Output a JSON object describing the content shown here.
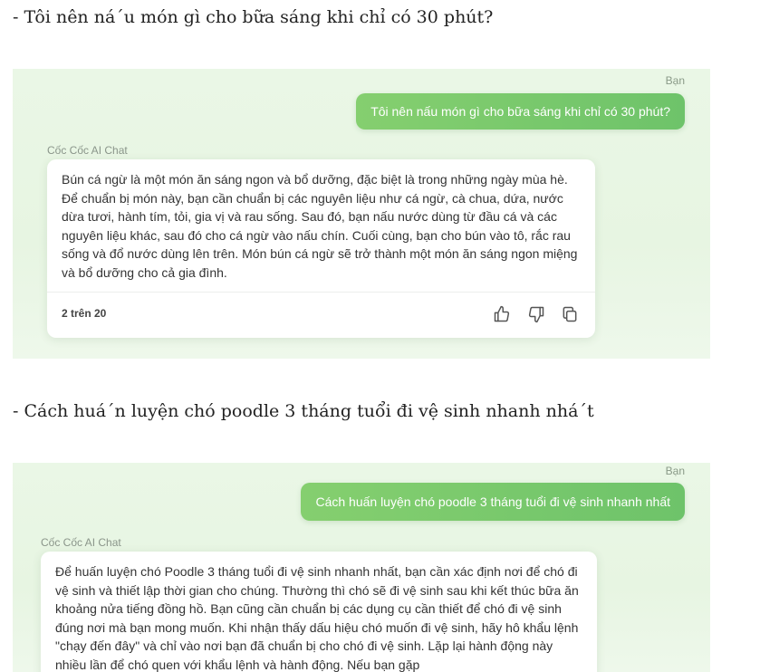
{
  "sections": [
    {
      "heading": "- Tôi nên ná´u món gì cho bữa sáng khi chỉ có 30 phút?",
      "you_label": "Bạn",
      "user_message": "Tôi nên nấu món gì cho bữa sáng khi chỉ có 30 phút?",
      "ai_label": "Cốc Cốc AI Chat",
      "ai_message": "Bún cá ngừ là một món ăn sáng ngon và bổ dưỡng, đặc biệt là trong những ngày mùa hè. Để chuẩn bị món này, bạn cần chuẩn bị các nguyên liệu như cá ngừ, cà chua, dứa, nước dừa tươi, hành tím, tỏi, gia vị và rau sống. Sau đó, bạn nấu nước dùng từ đầu cá và các nguyên liệu khác, sau đó cho cá ngừ vào nấu chín. Cuối cùng, bạn cho bún vào tô, rắc rau sống và đổ nước dùng lên trên. Món bún cá ngừ sẽ trở thành một món ăn sáng ngon miệng và bổ dưỡng cho cả gia đình.",
      "counter": "2 trên 20",
      "icons": [
        "thumbs-up-icon",
        "thumbs-down-icon",
        "copy-icon"
      ]
    },
    {
      "heading": "- Cách huá´n luyện chó poodle 3 tháng tuổi đi vệ sinh nhanh nhá´t",
      "you_label": "Bạn",
      "user_message": "Cách huấn luyện chó poodle 3 tháng tuổi đi vệ sinh nhanh nhất",
      "ai_label": "Cốc Cốc AI Chat",
      "ai_message": "Để huấn luyện chó Poodle 3 tháng tuổi đi vệ sinh nhanh nhất, bạn cần xác định nơi để chó đi vệ sinh và thiết lập thời gian cho chúng. Thường thì chó sẽ đi vệ sinh sau khi kết thúc bữa ăn khoảng nửa tiếng đồng hồ. Bạn cũng cần chuẩn bị các dụng cụ cần thiết để chó đi vệ sinh đúng nơi mà bạn mong muốn. Khi nhận thấy dấu hiệu chó muốn đi vệ sinh, hãy hô khẩu lệnh \"chạy đến đây\" và chỉ vào nơi bạn đã chuẩn bị cho chó đi vệ sinh. Lặp lại hành động này nhiều lần để chó quen với khẩu lệnh và hành động. Nếu bạn gặp"
    }
  ]
}
